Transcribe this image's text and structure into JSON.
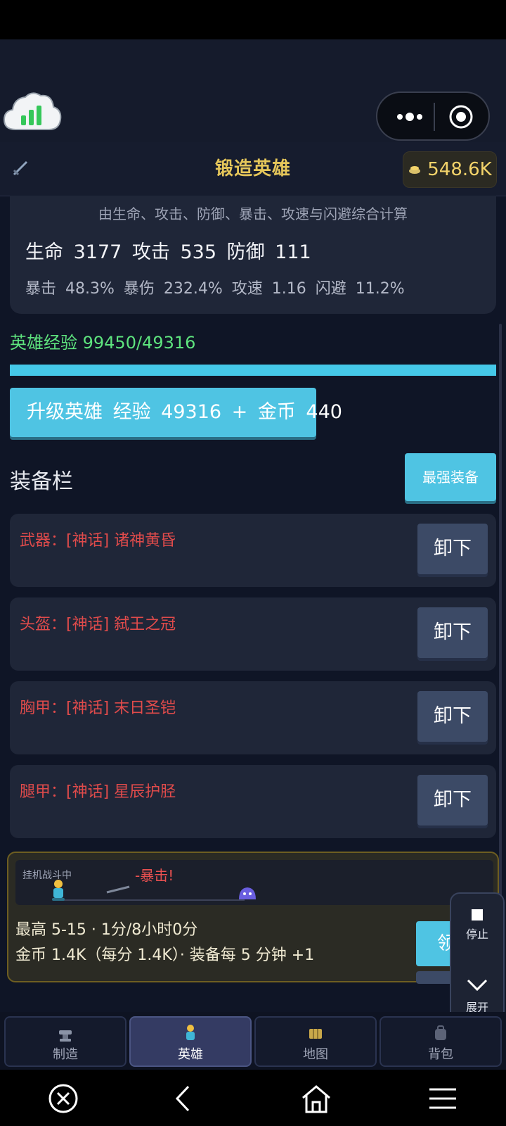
{
  "title_bar": {
    "title": "锻造英雄",
    "gold": "548.6K"
  },
  "stats": {
    "note": "由生命、攻击、防御、暴击、攻速与闪避综合计算",
    "main_line": "生命 3177  攻击 535  防御 111",
    "sub_line": "暴击 48.3%  暴伤 232.4%  攻速 1.16  闪避 11.2%"
  },
  "experience": {
    "label": "英雄经验 99450/49316",
    "progress": 1.0
  },
  "upgrade": {
    "label": "升级英雄  经验 49316 + 金币 440"
  },
  "equipment": {
    "title": "装备栏",
    "best_label": "最强装备",
    "slots": [
      {
        "label": "武器：[神话] 诸神黄昏",
        "action": "卸下"
      },
      {
        "label": "头盔：[神话] 弑王之冠",
        "action": "卸下"
      },
      {
        "label": "胸甲：[神话] 末日圣铠",
        "action": "卸下"
      },
      {
        "label": "腿甲：[神话] 星辰护胫",
        "action": "卸下"
      }
    ]
  },
  "battle": {
    "status": "挂机战斗中",
    "crit": "-暴击!",
    "line1": "最高 5-15 · 1分/8小时0分",
    "line2": "金币 1.4K（每分 1.4K）· 装备每 5 分钟 +1",
    "claim_label": "领"
  },
  "float_controls": {
    "stop": "停止",
    "expand": "展开"
  },
  "tabs": [
    {
      "label": "制造",
      "icon": "anvil-icon",
      "active": false
    },
    {
      "label": "英雄",
      "icon": "hero-icon",
      "active": true
    },
    {
      "label": "地图",
      "icon": "map-icon",
      "active": false
    },
    {
      "label": "背包",
      "icon": "backpack-icon",
      "active": false
    }
  ],
  "colors": {
    "accent": "#4fc4e3",
    "gold": "#e5c65a",
    "exp_green": "#5ee47e",
    "mythic_red": "#e04b4b",
    "background": "#0f1526"
  }
}
